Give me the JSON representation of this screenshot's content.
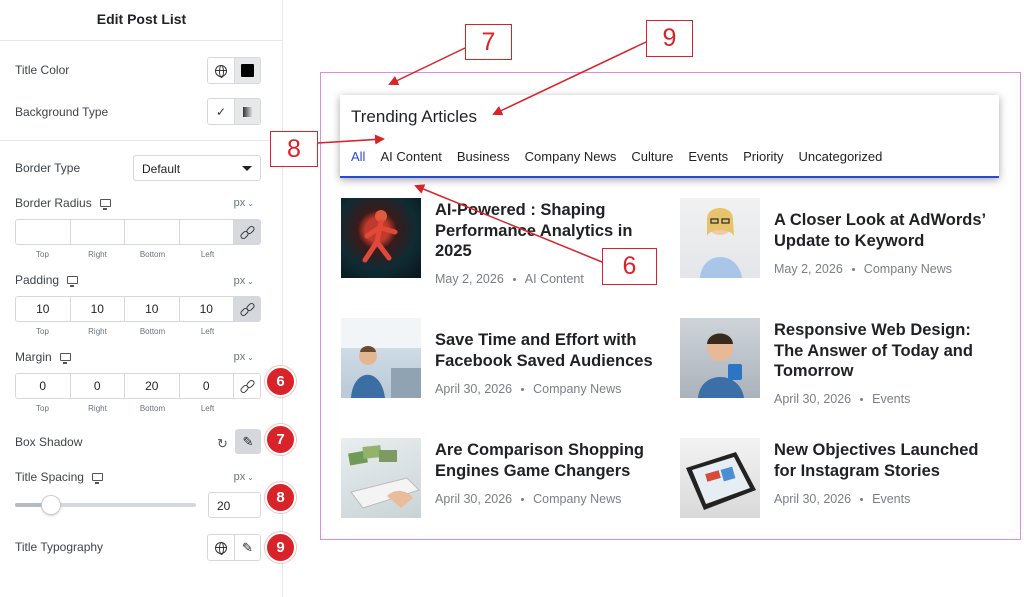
{
  "panel": {
    "title": "Edit Post List",
    "title_color_label": "Title Color",
    "background_type_label": "Background Type",
    "border_type_label": "Border Type",
    "border_type_value": "Default",
    "border_radius_label": "Border Radius",
    "border_radius_unit": "px",
    "border_radius_values": [
      "",
      "",
      "",
      ""
    ],
    "dim_labels": [
      "Top",
      "Right",
      "Bottom",
      "Left"
    ],
    "padding_label": "Padding",
    "padding_unit": "px",
    "padding_values": [
      "10",
      "10",
      "10",
      "10"
    ],
    "margin_label": "Margin",
    "margin_unit": "px",
    "margin_values": [
      "0",
      "0",
      "20",
      "0"
    ],
    "box_shadow_label": "Box Shadow",
    "title_spacing_label": "Title Spacing",
    "title_spacing_unit": "px",
    "title_spacing_value": "20",
    "title_spacing_slider_fraction": 0.2,
    "title_typography_label": "Title Typography"
  },
  "badges": [
    "6",
    "7",
    "8",
    "9"
  ],
  "preview": {
    "widget_title": "Trending Articles",
    "tabs": [
      "All",
      "AI Content",
      "Business",
      "Company News",
      "Culture",
      "Events",
      "Priority",
      "Uncategorized"
    ],
    "active_tab": "All",
    "posts": [
      {
        "title_lines": [
          "AI-Powered : Shaping",
          "Performance Analytics in",
          "2025"
        ],
        "date": "May 2, 2026",
        "category": "AI Content"
      },
      {
        "title_lines": [
          "A Closer Look at AdWords’",
          "Update to Keyword"
        ],
        "date": "May 2, 2026",
        "category": "Company News"
      },
      {
        "title_lines": [
          "Save Time and Effort with",
          "Facebook Saved Audiences"
        ],
        "date": "April 30, 2026",
        "category": "Company News"
      },
      {
        "title_lines": [
          "Responsive Web Design:",
          "The Answer of Today and",
          "Tomorrow"
        ],
        "date": "April 30, 2026",
        "category": "Events"
      },
      {
        "title_lines": [
          "Are Comparison Shopping",
          "Engines Game Changers"
        ],
        "date": "April 30, 2026",
        "category": "Company News"
      },
      {
        "title_lines": [
          "New Objectives Launched",
          "for Instagram Stories"
        ],
        "date": "April 30, 2026",
        "category": "Events"
      }
    ]
  },
  "annotations": [
    "7",
    "9",
    "8",
    "6"
  ],
  "colors": {
    "accent": "#2c47d6",
    "annotation_red": "#d8232a",
    "preview_border": "#d98ee0"
  }
}
